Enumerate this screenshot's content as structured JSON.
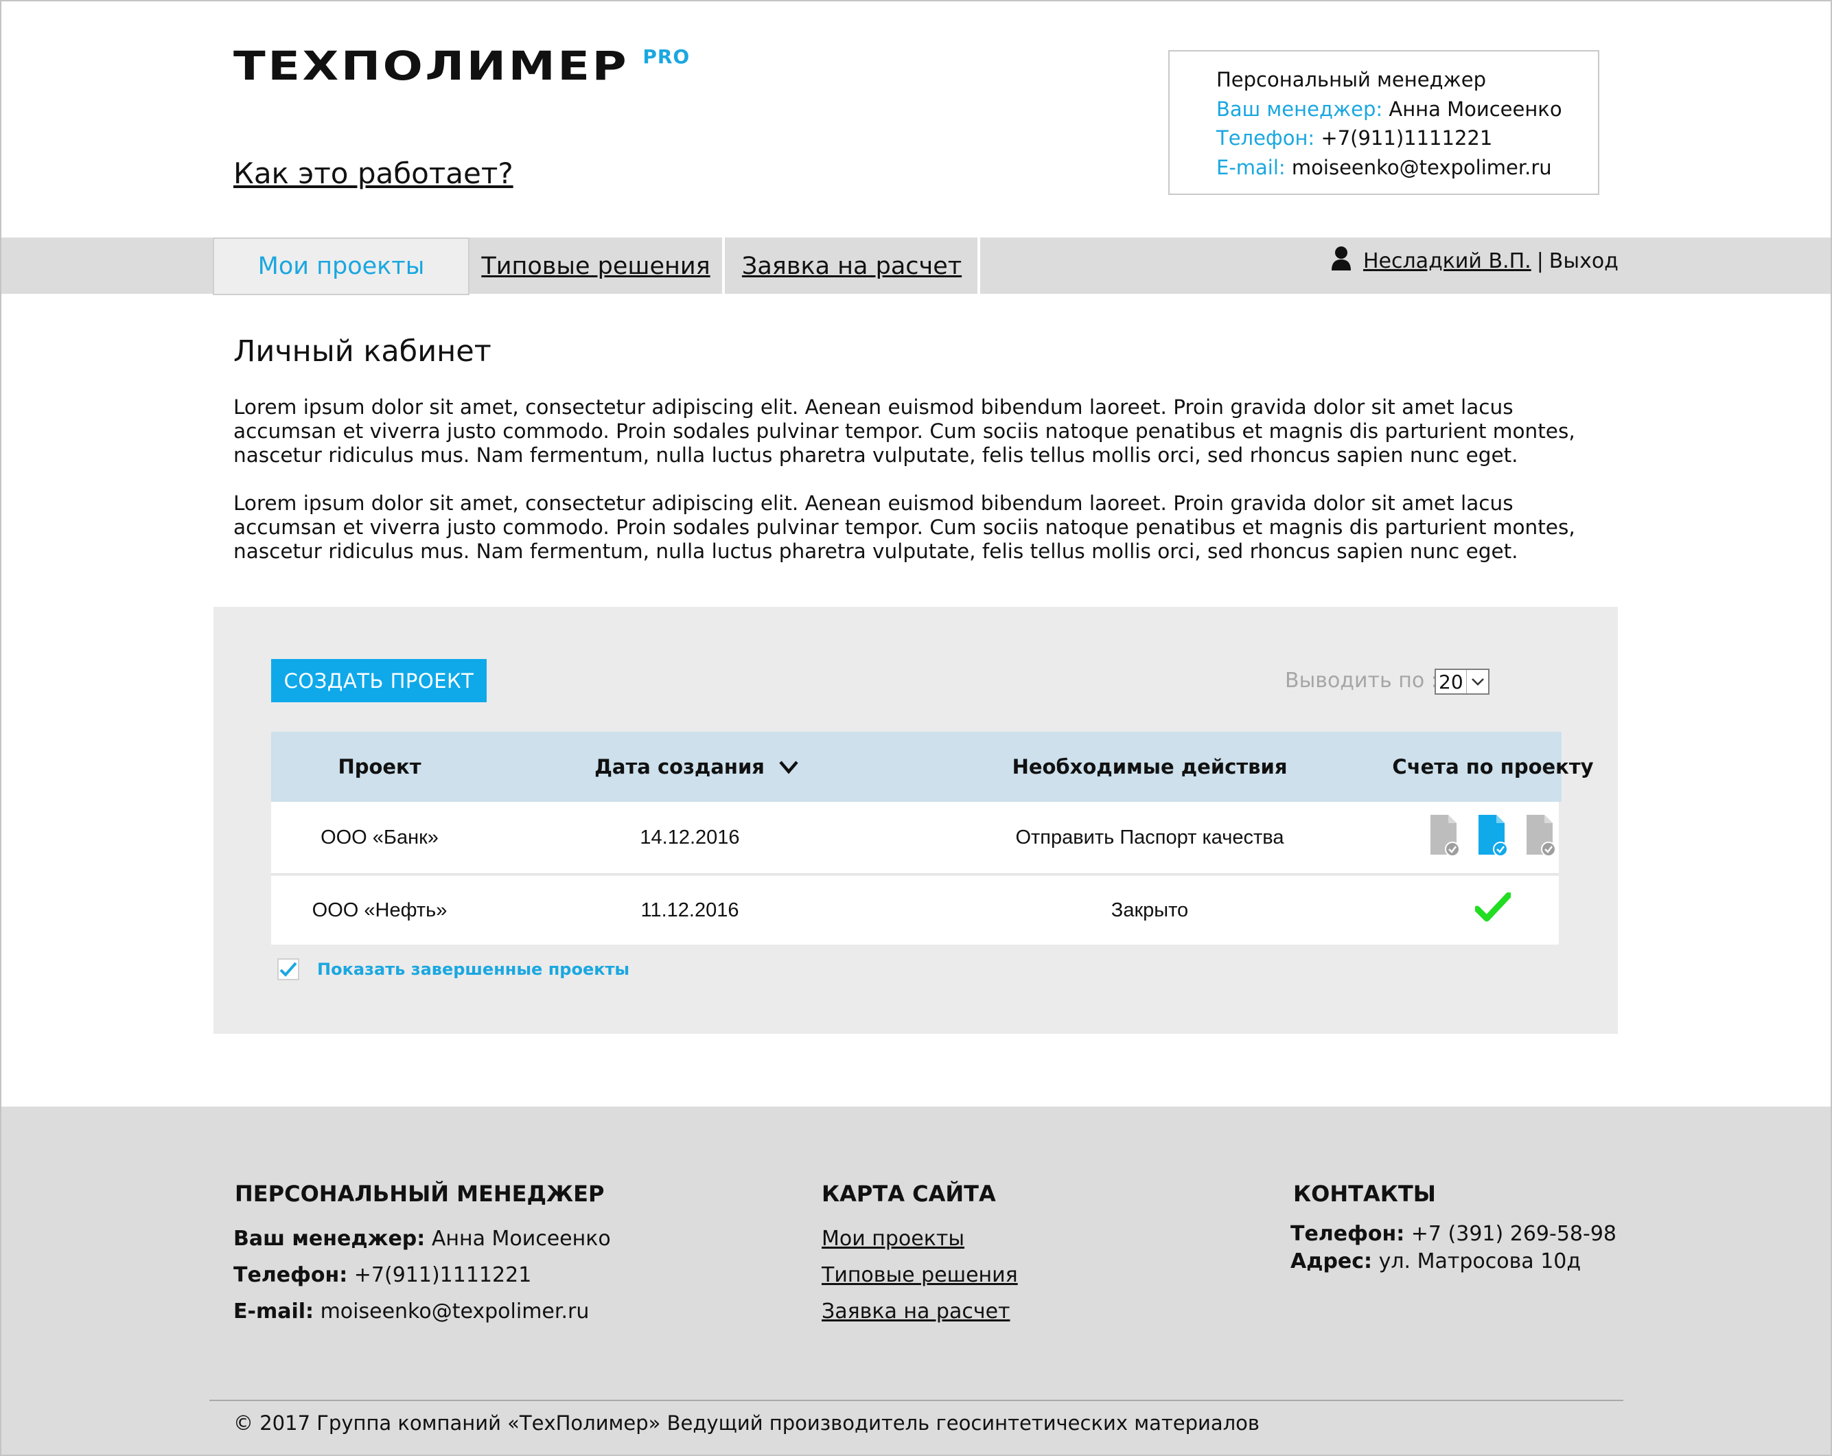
{
  "header": {
    "logo_main": "ТЕХПОЛИМЕР",
    "logo_pro": "PRO",
    "how_it_works": "Как это работает?"
  },
  "manager_box": {
    "title": "Персональный менеджер",
    "manager_label": "Ваш менеджер:",
    "manager_name": "Анна Моисеенко",
    "phone_label": "Телефон:",
    "phone": "+7(911)1111221",
    "email_label": "E-mail:",
    "email": "moiseenko@texpolimer.ru"
  },
  "nav": {
    "tabs": [
      {
        "label": "Мои проекты",
        "active": true
      },
      {
        "label": "Типовые решения"
      },
      {
        "label": "Заявка на расчет"
      }
    ],
    "user_name": "Несладкий В.П.",
    "separator": "|",
    "logout": "Выход"
  },
  "content": {
    "title": "Личный кабинет",
    "paragraphs": [
      "Lorem ipsum dolor sit amet, consectetur adipiscing elit. Aenean euismod bibendum laoreet. Proin gravida dolor sit amet lacus accumsan et viverra justo commodo. Proin sodales pulvinar tempor. Cum sociis natoque penatibus et magnis dis parturient montes, nascetur ridiculus mus. Nam fermentum, nulla luctus pharetra vulputate, felis tellus mollis orci, sed rhoncus sapien nunc eget.",
      "Lorem ipsum dolor sit amet, consectetur adipiscing elit. Aenean euismod bibendum laoreet. Proin gravida dolor sit amet lacus accumsan et viverra justo commodo. Proin sodales pulvinar tempor. Cum sociis natoque penatibus et magnis dis parturient montes, nascetur ridiculus mus. Nam fermentum, nulla luctus pharetra vulputate, felis tellus mollis orci, sed rhoncus sapien nunc eget."
    ]
  },
  "projects": {
    "create_button": "СОЗДАТЬ ПРОЕКТ",
    "per_page_label": "Выводить по :",
    "per_page_value": "20",
    "columns": [
      "Проект",
      "Дата создания",
      "Необходимые действия",
      "Счета по проекту"
    ],
    "rows": [
      {
        "project": "ООО «Банк»",
        "date": "14.12.2016",
        "action": "Отправить Паспорт качества",
        "invoices": [
          "document-icon-gray",
          "document-icon-blue",
          "document-icon-gray"
        ]
      },
      {
        "project": "ООО «Нефть»",
        "date": "11.12.2016",
        "action": "Закрыто",
        "invoices": [
          "green-check-icon"
        ]
      }
    ],
    "show_completed_label": "Показать завершенные проекты",
    "show_completed_checked": true
  },
  "footer": {
    "manager": {
      "heading": "ПЕРСОНАЛЬНЫЙ МЕНЕДЖЕР",
      "manager_label": "Ваш менеджер:",
      "manager_name": "Анна Моисеенко",
      "phone_label": "Телефон:",
      "phone": "+7(911)1111221",
      "email_label": "E-mail:",
      "email": "moiseenko@texpolimer.ru"
    },
    "sitemap": {
      "heading": "КАРТА САЙТА",
      "links": [
        "Мои проекты",
        "Типовые решения",
        "Заявка на расчет"
      ]
    },
    "contacts": {
      "heading": "КОНТАКТЫ",
      "phone_label": "Телефон:",
      "phone": "+7 (391) 269-58-98",
      "address_label": "Адрес:",
      "address": "ул. Матросова 10д"
    },
    "copyright": "© 2017 Группа компаний «ТехПолимер» Ведущий производитель геосинтетических материалов"
  },
  "colors": {
    "accent": "#1aa7e0",
    "button": "#0fa9ea",
    "table_header": "#cde0ec",
    "panel": "#ebebeb",
    "bars": "#dcdcdc",
    "check": "#22dd22"
  }
}
